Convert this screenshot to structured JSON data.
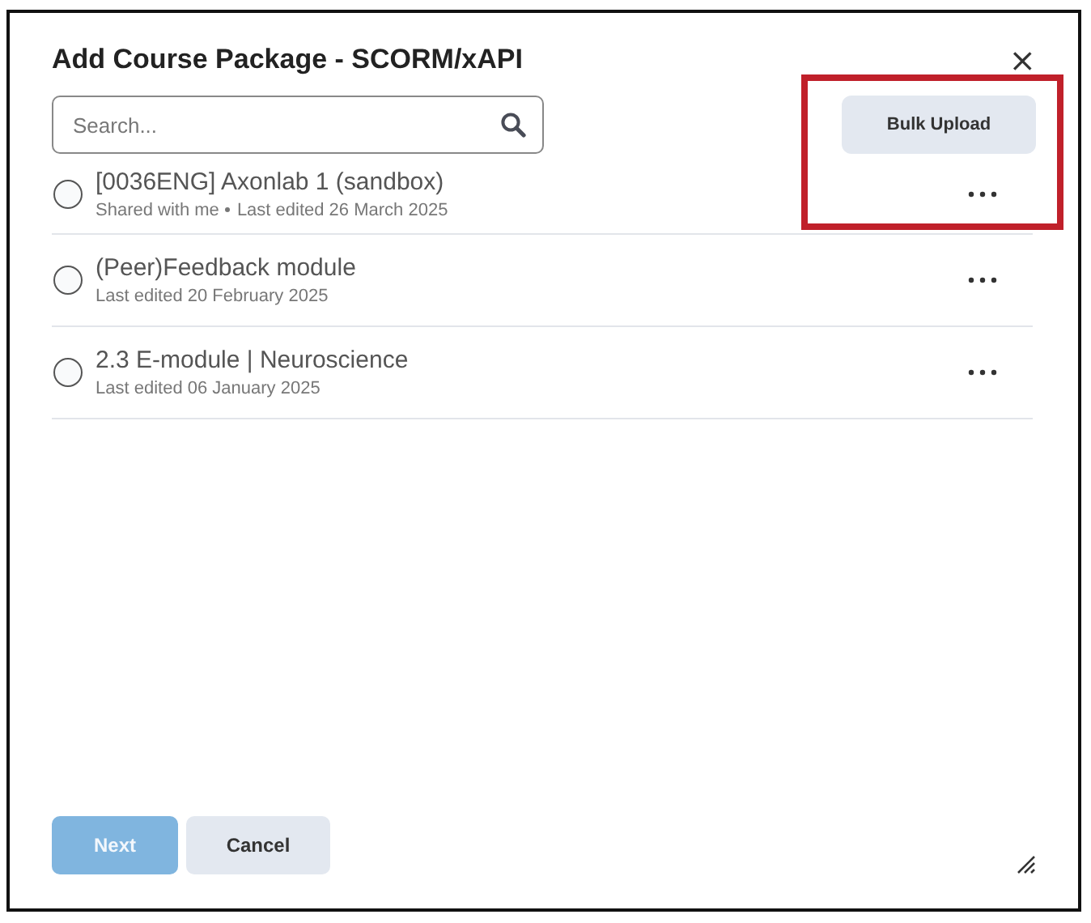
{
  "dialog": {
    "title": "Add Course Package - SCORM/xAPI",
    "close": "×"
  },
  "search": {
    "placeholder": "Search..."
  },
  "bulk_upload": {
    "label": "Bulk Upload",
    "highlighted": true
  },
  "items": [
    {
      "title": "[0036ENG] Axonlab 1 (sandbox)",
      "shared": "Shared with me",
      "edited": "Last edited 26 March 2025",
      "selected": false
    },
    {
      "title": "(Peer)Feedback module",
      "edited": "Last edited 20 February 2025",
      "selected": false
    },
    {
      "title": "2.3 E-module | Neuroscience",
      "edited": "Last edited 06 January 2025",
      "selected": false
    }
  ],
  "buttons": [
    {
      "label": "Next",
      "kind": "primary",
      "disabled": true
    },
    {
      "label": "Cancel",
      "kind": "secondary",
      "disabled": false
    }
  ]
}
